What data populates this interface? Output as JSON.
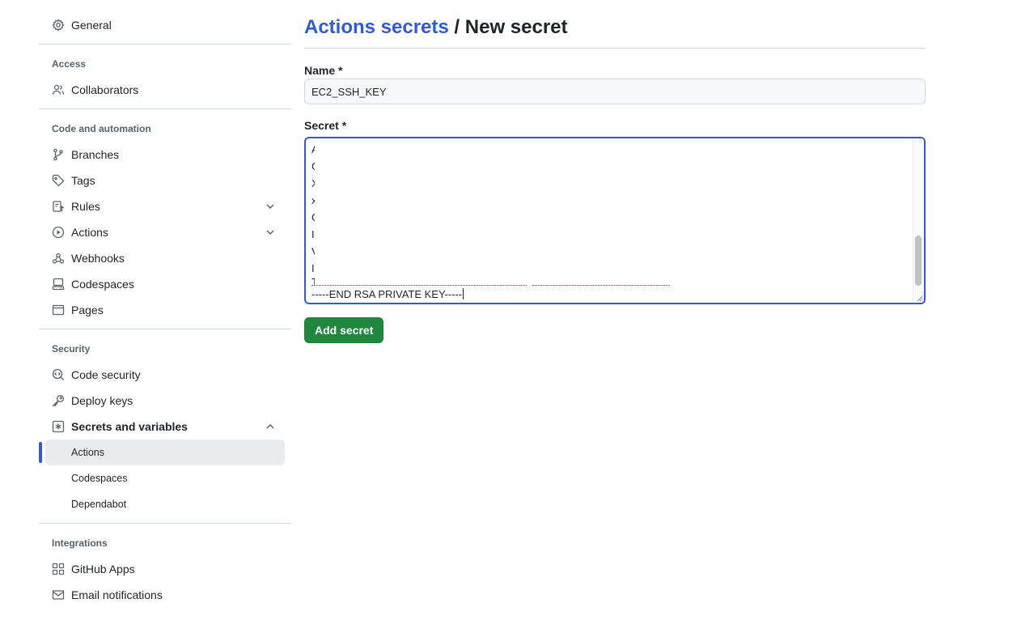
{
  "sidebar": {
    "general": "General",
    "access": {
      "title": "Access",
      "collaborators": "Collaborators"
    },
    "code_automation": {
      "title": "Code and automation",
      "branches": "Branches",
      "tags": "Tags",
      "rules": "Rules",
      "actions": "Actions",
      "webhooks": "Webhooks",
      "codespaces": "Codespaces",
      "pages": "Pages"
    },
    "security": {
      "title": "Security",
      "code_security": "Code security",
      "deploy_keys": "Deploy keys",
      "secrets_variables": "Secrets and variables",
      "sub": {
        "actions": "Actions",
        "codespaces": "Codespaces",
        "dependabot": "Dependabot"
      }
    },
    "integrations": {
      "title": "Integrations",
      "github_apps": "GitHub Apps",
      "email_notifications": "Email notifications"
    }
  },
  "main": {
    "breadcrumb_link": "Actions secrets",
    "breadcrumb_sep": "/",
    "breadcrumb_current": "New secret",
    "name_label": "Name *",
    "name_value": "EC2_SSH_KEY",
    "secret_label": "Secret *",
    "secret_end_line": "-----END RSA PRIVATE KEY-----",
    "add_button": "Add secret"
  },
  "colors": {
    "link": "#2d5bd8",
    "accent_bar": "#2f5bd6",
    "button_green": "#1f883d",
    "selected_bg": "#e9ebee"
  }
}
